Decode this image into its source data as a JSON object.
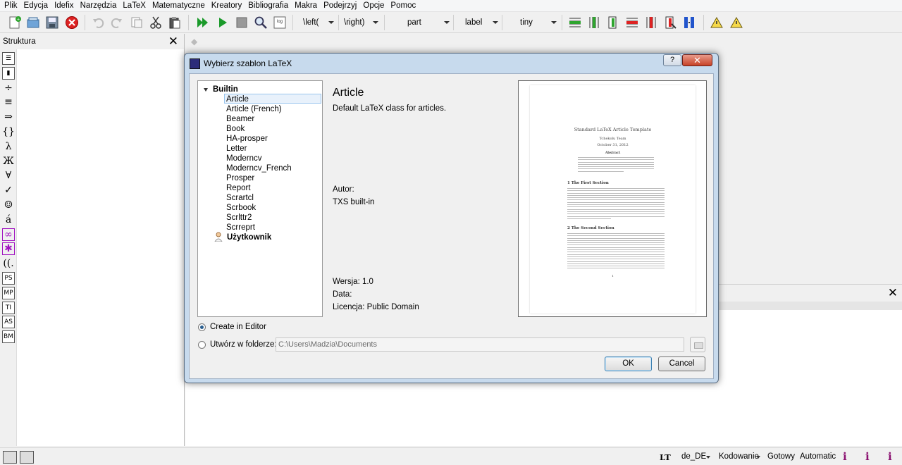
{
  "menu": [
    "Plik",
    "Edycja",
    "Idefix",
    "Narzędzia",
    "LaTeX",
    "Matematyczne",
    "Kreatory",
    "Bibliografia",
    "Makra",
    "Podejrzyj",
    "Opcje",
    "Pomoc"
  ],
  "toolbar": {
    "left_delim": "\\left(",
    "right_delim": "\\right)",
    "combo_part": "part",
    "combo_label": "label",
    "combo_size": "tiny",
    "log_icon_text": "log"
  },
  "structure_panel": {
    "title": "Struktura",
    "symbols": [
      "⇒",
      "{}",
      "λ",
      "Ж",
      "∀",
      "✓",
      "☺",
      "á",
      "∞",
      "✱",
      "((.",
      "PS",
      "MP",
      "TI",
      "AS",
      "BM"
    ]
  },
  "dialog": {
    "title": "Wybierz szablon LaTeX",
    "help_label": "?",
    "close_label": "✕",
    "tree": {
      "group_builtin": "Builtin",
      "items": [
        "Article",
        "Article (French)",
        "Beamer",
        "Book",
        "HA-prosper",
        "Letter",
        "Moderncv",
        "Moderncv_French",
        "Prosper",
        "Report",
        "Scrartcl",
        "Scrbook",
        "Scrlttr2",
        "Scrreprt"
      ],
      "selected": "Article",
      "group_user": "Użytkownik"
    },
    "template": {
      "name": "Article",
      "description": "Default LaTeX class for articles.",
      "author_label": "Autor:",
      "author": "TXS built-in",
      "version": "Wersja: 1.0",
      "date_label": "Data:",
      "license": "Licencja: Public Domain"
    },
    "preview": {
      "title": "Standard LaTeX Article Template",
      "author": "Tchekolu Team",
      "date": "October 31, 2012",
      "abstract_heading": "Abstract",
      "section1": "1   The First Section",
      "section2": "2   The Second Section",
      "page_number": "1"
    },
    "create_in_editor": "Create in Editor",
    "create_in_folder": "Utwórz w folderze:",
    "folder_path": "C:\\Users\\Madzia\\Documents",
    "ok": "OK",
    "cancel": "Cancel"
  },
  "statusbar": {
    "lt_icon": "LT",
    "language": "de_DE",
    "encoding": "Kodowanie",
    "status": "Gotowy",
    "mode": "Automatic"
  }
}
